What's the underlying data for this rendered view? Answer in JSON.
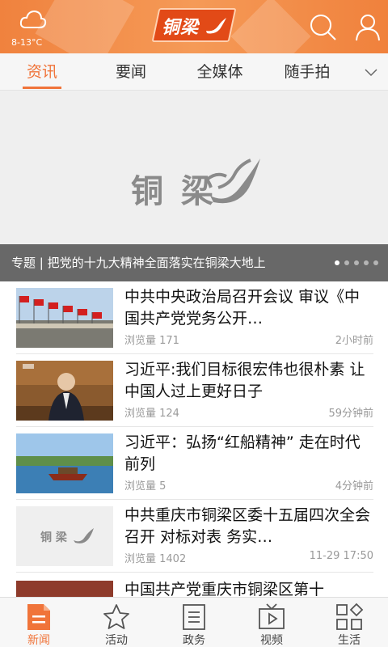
{
  "header": {
    "temperature": "8-13°C",
    "logo_text": "铜梁",
    "weather_icon": "cloud-icon",
    "search_icon": "search-icon",
    "profile_icon": "user-icon"
  },
  "tabs": [
    {
      "label": "资讯",
      "active": true
    },
    {
      "label": "要闻",
      "active": false
    },
    {
      "label": "全媒体",
      "active": false
    },
    {
      "label": "随手拍",
      "active": false
    }
  ],
  "banner": {
    "logo_text": "铜 梁",
    "caption": "专题 | 把党的十九大精神全面落实在铜梁大地上",
    "dots": 5,
    "active_dot": 0
  },
  "news": [
    {
      "title": "中共中央政治局召开会议 审议《中国共产党党务公开…",
      "views": "浏览量 171",
      "time": "2小时前",
      "thumb": "flags"
    },
    {
      "title": "习近平:我们目标很宏伟也很朴素 让中国人过上更好日子",
      "views": "浏览量 124",
      "time": "59分钟前",
      "thumb": "speech"
    },
    {
      "title": "习近平：弘扬“红船精神” 走在时代前列",
      "views": "浏览量 5",
      "time": "4分钟前",
      "thumb": "boat"
    },
    {
      "title": "中共重庆市铜梁区委十五届四次全会召开 对标对表  务实…",
      "views": "浏览量 1402",
      "time": "11-29 17:50",
      "thumb": "logo"
    },
    {
      "title": "中国共产党重庆市铜梁区第十",
      "views": "",
      "time": "",
      "thumb": "partial"
    }
  ],
  "thumb_logo_text": "铜 梁",
  "bottom_nav": [
    {
      "label": "新闻",
      "icon": "news-icon",
      "active": true
    },
    {
      "label": "活动",
      "icon": "star-icon",
      "active": false
    },
    {
      "label": "政务",
      "icon": "document-icon",
      "active": false
    },
    {
      "label": "视频",
      "icon": "tv-play-icon",
      "active": false
    },
    {
      "label": "生活",
      "icon": "grid-icon",
      "active": false
    }
  ],
  "colors": {
    "accent": "#f0743a",
    "header": "#f28b48"
  }
}
